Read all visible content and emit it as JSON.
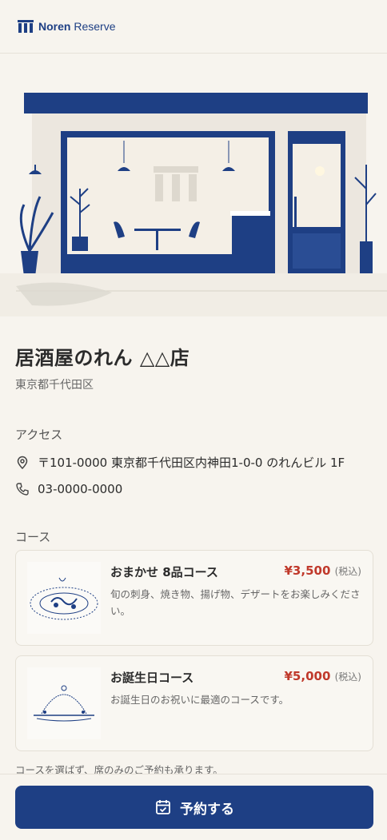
{
  "header": {
    "brand_bold": "Noren",
    "brand_regular": "Reserve"
  },
  "store": {
    "name": "居酒屋のれん △△店",
    "area": "東京都千代田区"
  },
  "access": {
    "title": "アクセス",
    "address": "〒101-0000 東京都千代田区内神田1-0-0 のれんビル 1F",
    "phone": "03-0000-0000"
  },
  "courses": {
    "title": "コース",
    "items": [
      {
        "name": "おまかせ 8品コース",
        "price": "¥3,500",
        "tax": "(税込)",
        "description": "旬の刺身、焼き物、揚げ物、デザートをお楽しみください。"
      },
      {
        "name": "お誕生日コース",
        "price": "¥5,000",
        "tax": "(税込)",
        "description": "お誕生日のお祝いに最適のコースです。"
      }
    ]
  },
  "note": "コースを選ばず、席のみのご予約も承ります。",
  "reserve_button": "予約する",
  "colors": {
    "brand": "#1e3f84",
    "price": "#c0392b",
    "background": "#f7f4ee"
  }
}
